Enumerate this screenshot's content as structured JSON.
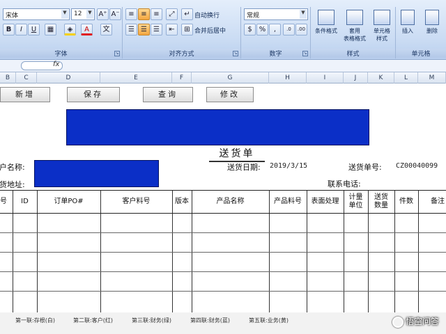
{
  "ribbon": {
    "font_group": {
      "label": "字体",
      "font_name": "宋体",
      "font_size": "12",
      "grow_symbol": "A⁺",
      "shrink_symbol": "A⁻",
      "bold": "B",
      "italic": "I",
      "underline": "U",
      "fill_letter": "A"
    },
    "align_group": {
      "label": "对齐方式",
      "wrap_text": "自动换行",
      "merge_center": "合并后居中"
    },
    "number_group": {
      "label": "数字",
      "format": "常规",
      "currency": "$",
      "percent": "%",
      "comma": ",",
      "inc_dec": ".0",
      "dec_dec": ".00"
    },
    "styles_group": {
      "label": "样式",
      "conditional": "条件格式",
      "as_table_l1": "套用",
      "as_table_l2": "表格格式",
      "cell_styles_l1": "单元格",
      "cell_styles_l2": "样式"
    },
    "cells_group": {
      "label": "单元格",
      "insert": "插入",
      "delete": "删除"
    }
  },
  "formula_bar": {
    "fx": "fx"
  },
  "column_headers": [
    "B",
    "C",
    "D",
    "E",
    "F",
    "G",
    "H",
    "I",
    "J",
    "K",
    "L",
    "M"
  ],
  "actions": {
    "add": "新增",
    "save": "保存",
    "query": "查询",
    "edit": "修改"
  },
  "sheet": {
    "title": "送货单",
    "customer_label": "客户名称:",
    "address_label": "收货地址:",
    "date_label": "送货日期:",
    "date_value": "2019/3/15",
    "number_label": "送货单号:",
    "number_value": "CZ00040099",
    "contact_label": "联系电话:"
  },
  "table": {
    "headers": [
      "序号",
      "ID",
      "订单PO#",
      "客户料号",
      "版本",
      "产品名称",
      "产品料号",
      "表面处理",
      "计量单位",
      "送货数量",
      "件数",
      "备注"
    ],
    "empty_rows": 5
  },
  "footer": {
    "copies": [
      "第一联:存根(白)",
      "第二联:客户(红)",
      "第三联:财务(绿)",
      "第四联:财务(蓝)",
      "第五联:业务(黄)"
    ],
    "watermark": "悟空问答"
  },
  "colors": {
    "banner": "#0b2fc7",
    "ribbon": "#c9dbf3",
    "active_align": "#f4a640"
  }
}
